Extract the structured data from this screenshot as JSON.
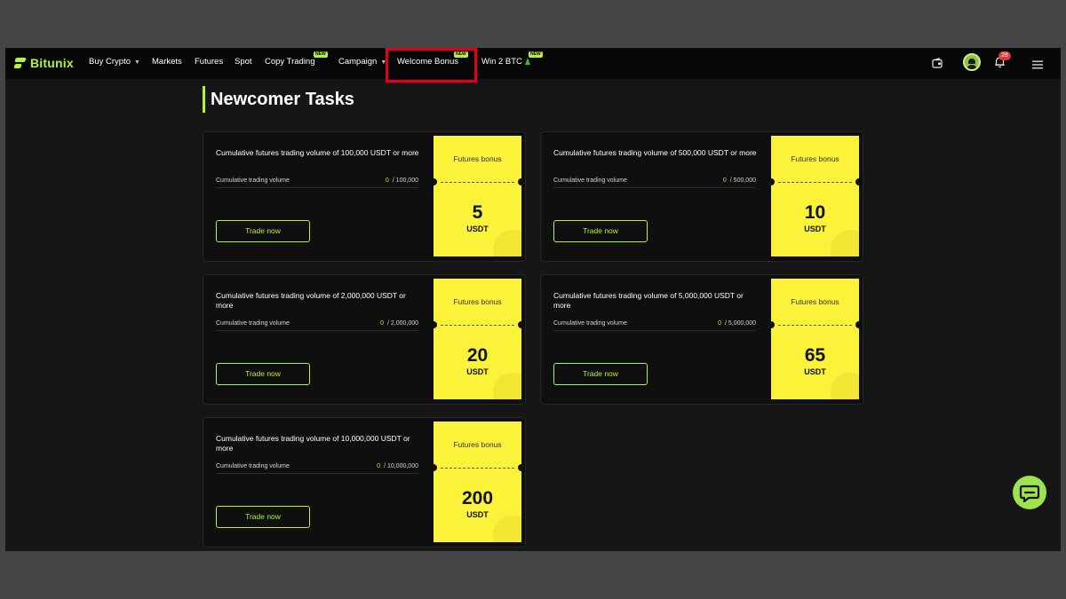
{
  "nav": {
    "logo_text": "Bitunix",
    "items": [
      {
        "label": "Buy Crypto",
        "has_caret": true
      },
      {
        "label": "Markets"
      },
      {
        "label": "Futures"
      },
      {
        "label": "Spot"
      },
      {
        "label": "Copy Trading",
        "badge": "NEW"
      },
      {
        "label": "Campaign",
        "has_caret": true
      },
      {
        "label": "Welcome Bonus",
        "badge": "NEW",
        "highlighted": true
      },
      {
        "label": "Win 2 BTC",
        "badge": "NEW"
      }
    ],
    "notification_count": "28",
    "icons": [
      "wallet-icon",
      "avatar",
      "bell-icon",
      "menu-icon"
    ]
  },
  "page": {
    "title": "Newcomer Tasks"
  },
  "tasks": [
    {
      "title": "Cumulative futures trading volume of 100,000  USDT or more",
      "label": "Cumulative trading volume",
      "current": "0",
      "target": "/ 100,000",
      "button": "Trade now",
      "bonus_label": "Futures bonus",
      "amount": "5",
      "unit": "USDT"
    },
    {
      "title": "Cumulative futures trading volume of 500,000  USDT or more",
      "label": "Cumulative trading volume",
      "current": "0",
      "target": "/ 500,000",
      "button": "Trade now",
      "bonus_label": "Futures bonus",
      "amount": "10",
      "unit": "USDT"
    },
    {
      "title": "Cumulative futures trading volume of 2,000,000  USDT or more",
      "label": "Cumulative trading volume",
      "current": "0",
      "target": "/ 2,000,000",
      "button": "Trade now",
      "bonus_label": "Futures bonus",
      "amount": "20",
      "unit": "USDT"
    },
    {
      "title": "Cumulative futures trading volume of 5,000,000  USDT or more",
      "label": "Cumulative trading volume",
      "current": "0",
      "target": "/ 5,000,000",
      "button": "Trade now",
      "bonus_label": "Futures bonus",
      "amount": "65",
      "unit": "USDT"
    },
    {
      "title": "Cumulative futures trading volume of 10,000,000  USDT or more",
      "label": "Cumulative trading volume",
      "current": "0",
      "target": "/ 10,000,000",
      "button": "Trade now",
      "bonus_label": "Futures bonus",
      "amount": "200",
      "unit": "USDT"
    }
  ],
  "colors": {
    "accent": "#b3f43a",
    "ticket": "#fbf23a",
    "highlight_box": "#e4001b",
    "background": "#161616"
  }
}
